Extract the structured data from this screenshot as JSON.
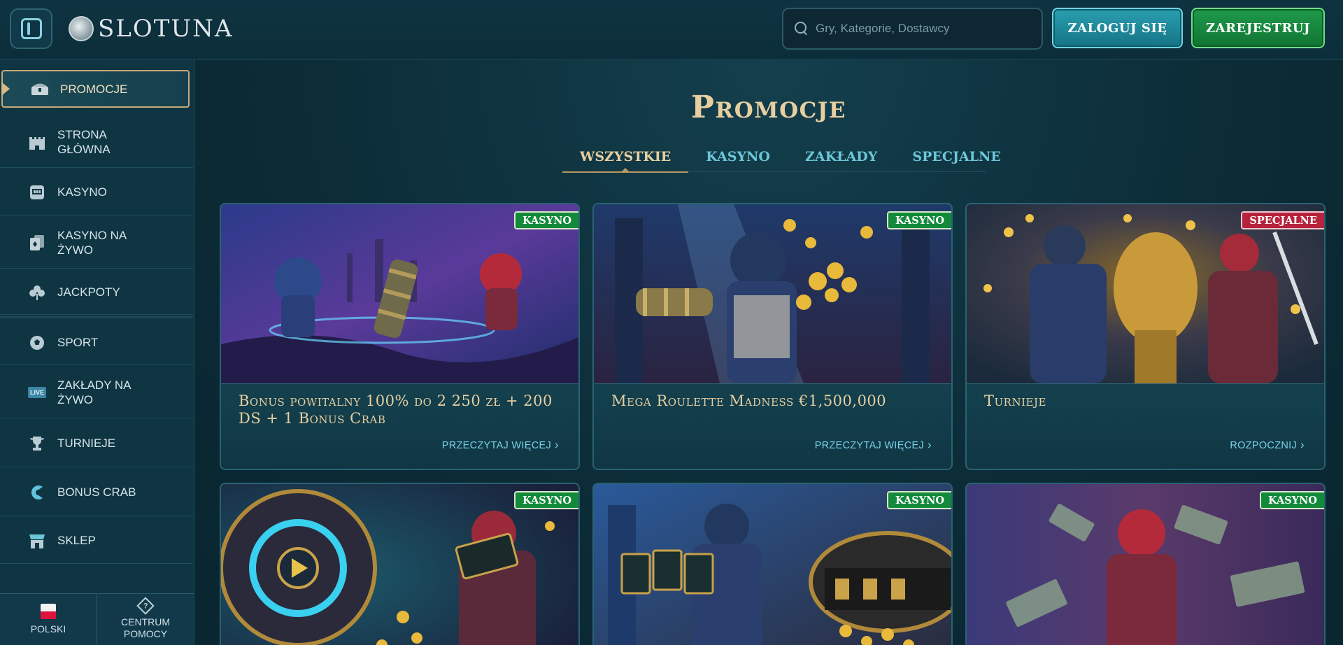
{
  "header": {
    "logo_text": "SLOTUNA",
    "search_placeholder": "Gry, Kategorie, Dostawcy",
    "login_label": "ZALOGUJ SIĘ",
    "register_label": "ZAREJESTRUJ"
  },
  "sidebar": {
    "items": [
      {
        "label": "PROMOCJE",
        "icon": "treasure-chest-icon"
      },
      {
        "label": "STRONA GŁÓWNA",
        "icon": "castle-icon"
      },
      {
        "label": "KASYNO",
        "icon": "slot-machine-icon"
      },
      {
        "label": "KASYNO NA ŻYWO",
        "icon": "cards-icon"
      },
      {
        "label": "JACKPOTY",
        "icon": "clover-icon"
      },
      {
        "label": "SPORT",
        "icon": "football-icon"
      },
      {
        "label": "ZAKŁADY NA ŻYWO",
        "icon": "live-icon"
      },
      {
        "label": "TURNIEJE",
        "icon": "trophy-icon"
      },
      {
        "label": "BONUS CRAB",
        "icon": "crab-claw-icon"
      },
      {
        "label": "SKLEP",
        "icon": "shop-icon"
      }
    ],
    "live_icon_text": "LIVE",
    "language_label": "POLSKI",
    "help_label": "CENTRUM POMOCY"
  },
  "main": {
    "title": "Promocje",
    "tabs": [
      "WSZYSTKIE",
      "KASYNO",
      "ZAKŁADY",
      "SPECJALNE"
    ],
    "cards": [
      {
        "badge": "KASYNO",
        "badge_color": "#138a3b",
        "title": "Bonus powitalny 100% do 2 250 zł + 200 DS + 1 Bonus Crab",
        "cta": "PRZECZYTAJ WIĘCEJ"
      },
      {
        "badge": "KASYNO",
        "badge_color": "#138a3b",
        "title": "Mega Roulette Madness €1,500,000",
        "cta": "PRZECZYTAJ WIĘCEJ"
      },
      {
        "badge": "SPECJALNE",
        "badge_color": "#b7233c",
        "title": "Turnieje",
        "cta": "ROZPOCZNIJ"
      },
      {
        "badge": "KASYNO",
        "badge_color": "#138a3b"
      },
      {
        "badge": "KASYNO",
        "badge_color": "#138a3b"
      },
      {
        "badge": "KASYNO",
        "badge_color": "#138a3b"
      }
    ]
  }
}
